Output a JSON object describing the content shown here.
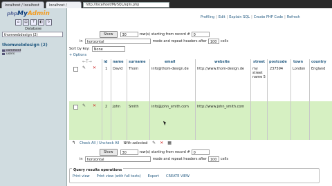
{
  "browser": {
    "tab1": "localhost / localhost / thomsondat...",
    "tab2": "localhost / MyS...",
    "url": "http://localhost/MySQL/sqlis.php"
  },
  "sidebar": {
    "logo_php": "php",
    "logo_my": "My",
    "logo_admin": "Admin",
    "db_label": "Database",
    "db_select": "thomwebdesign (2)",
    "db_heading": "thomwebdesign (2)",
    "tables": [
      "comment",
      "users"
    ]
  },
  "topnav": [
    "Profiling",
    "Edit",
    "Explain SQL",
    "Create PHP Code",
    "Refresh"
  ],
  "controls_top": {
    "show_button": "Show",
    "show_count": "30",
    "rows_starting": "row(s) starting from record #",
    "start_record": "0",
    "in_label": "in",
    "mode_value": "horizontal",
    "mode_text": "mode and repeat headers after",
    "repeat_after": "100",
    "cells_label": "cells",
    "sort_label": "Sort by key:",
    "sort_value": "None",
    "options_link": "+ Options"
  },
  "columns": [
    "id",
    "name",
    "surname",
    "email",
    "website",
    "street",
    "postcode",
    "town",
    "country"
  ],
  "rows": [
    {
      "id": "1",
      "name": "David",
      "surname": "Thom",
      "email": "info@thom-design.de",
      "website": "http://www.thom-design.de",
      "street": "my street name 5",
      "postcode": "237594",
      "town": "London",
      "country": "England"
    },
    {
      "id": "2",
      "name": "John",
      "surname": "Smith",
      "email": "info@john_smith.com",
      "website": "http://www.john_smith.com",
      "street": "",
      "postcode": "",
      "town": "",
      "country": ""
    }
  ],
  "bottom": {
    "check_all": "Check All / Uncheck All",
    "with_selected": "With selected:",
    "show_button": "Show",
    "show_count": "30",
    "rows_starting": "row(s) starting from record #",
    "start_record": "0",
    "in_label": "in",
    "mode_value": "horizontal",
    "mode_text": "mode and repeat headers after",
    "repeat_after": "100",
    "cells_label": "cells"
  },
  "query_ops": {
    "title": "Query results operations",
    "items": [
      "Print view",
      "Print view (with full texts)",
      "Export",
      "CREATE VIEW"
    ]
  }
}
